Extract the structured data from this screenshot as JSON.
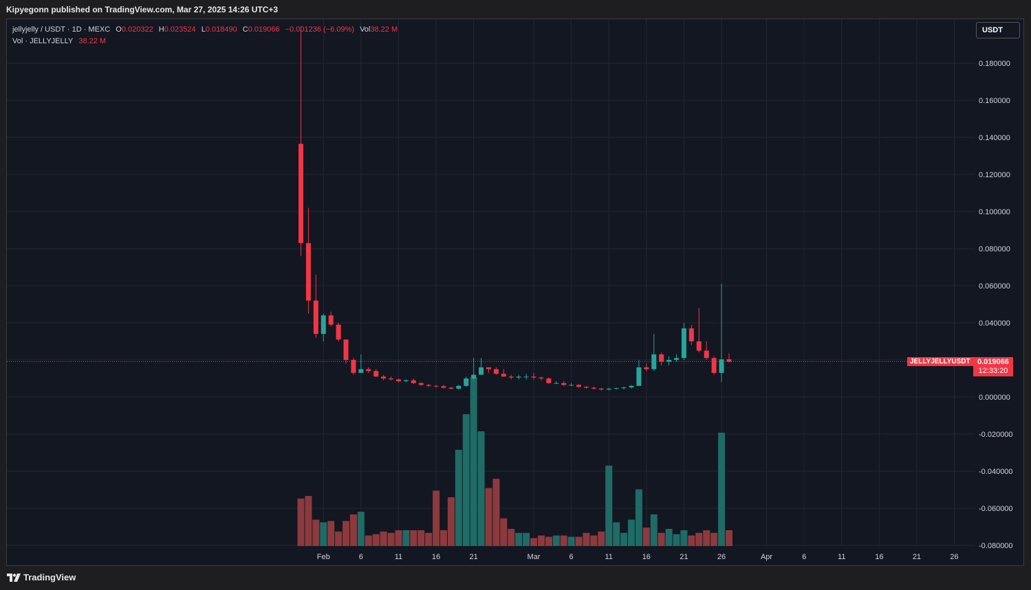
{
  "header": {
    "published": "Kipyegonn published on TradingView.com, Mar 27, 2025 14:26 UTC+3"
  },
  "legend": {
    "symbol": "jellyjelly / USDT · 1D · MEXC",
    "o_label": "O",
    "o": "0.020322",
    "h_label": "H",
    "h": "0.023524",
    "l_label": "L",
    "l": "0.018490",
    "c_label": "C",
    "c": "0.019066",
    "change": "−0.001236 (−6.09%)",
    "vol_label": "Vol",
    "vol": "38.22 M",
    "vol_row_label": "Vol · JELLYJELLY",
    "vol_row_value": "38.22 M"
  },
  "price_scale": {
    "unit": "USDT"
  },
  "last_price": {
    "symbol": "JELLYJELLYUSDT",
    "price": "0.019066",
    "countdown": "12:33:20"
  },
  "footer": {
    "brand": "TradingView"
  },
  "colors": {
    "up": "#26a69a",
    "down": "#f23645",
    "vol_up": "#1f6b66",
    "vol_down": "#8c3a3e",
    "background": "#131722",
    "grid": "#232733"
  },
  "chart_data": {
    "type": "candlestick",
    "ylim": [
      -0.08,
      0.2
    ],
    "y_ticks": [
      "0.180000",
      "0.160000",
      "0.140000",
      "0.120000",
      "0.100000",
      "0.080000",
      "0.060000",
      "0.040000",
      "0.020000",
      "0.000000",
      "-0.020000",
      "-0.040000",
      "-0.060000",
      "-0.080000"
    ],
    "y_tick_values": [
      0.18,
      0.16,
      0.14,
      0.12,
      0.1,
      0.08,
      0.06,
      0.04,
      0.02,
      0,
      -0.02,
      -0.04,
      -0.06,
      -0.08
    ],
    "x_ticks": [
      {
        "label": "Feb",
        "day": 3
      },
      {
        "label": "6",
        "day": 8
      },
      {
        "label": "11",
        "day": 13
      },
      {
        "label": "16",
        "day": 18
      },
      {
        "label": "21",
        "day": 23
      },
      {
        "label": "Mar",
        "day": 31
      },
      {
        "label": "6",
        "day": 36
      },
      {
        "label": "11",
        "day": 41
      },
      {
        "label": "16",
        "day": 46
      },
      {
        "label": "21",
        "day": 51
      },
      {
        "label": "26",
        "day": 56
      },
      {
        "label": "Apr",
        "day": 62
      },
      {
        "label": "6",
        "day": 67
      },
      {
        "label": "11",
        "day": 72
      },
      {
        "label": "16",
        "day": 77
      },
      {
        "label": "21",
        "day": 82
      },
      {
        "label": "26",
        "day": 87
      }
    ],
    "last_price": 0.019066,
    "candles": [
      {
        "day": 0,
        "o": 0.1365,
        "h": 0.2,
        "l": 0.076,
        "c": 0.083,
        "v": 0.36
      },
      {
        "day": 1,
        "o": 0.083,
        "h": 0.102,
        "l": 0.045,
        "c": 0.052,
        "v": 0.38
      },
      {
        "day": 2,
        "o": 0.052,
        "h": 0.066,
        "l": 0.032,
        "c": 0.034,
        "v": 0.2
      },
      {
        "day": 3,
        "o": 0.034,
        "h": 0.045,
        "l": 0.03,
        "c": 0.044,
        "v": 0.18
      },
      {
        "day": 4,
        "o": 0.044,
        "h": 0.046,
        "l": 0.038,
        "c": 0.039,
        "v": 0.19
      },
      {
        "day": 5,
        "o": 0.039,
        "h": 0.04,
        "l": 0.03,
        "c": 0.031,
        "v": 0.11
      },
      {
        "day": 6,
        "o": 0.031,
        "h": 0.031,
        "l": 0.018,
        "c": 0.02,
        "v": 0.19
      },
      {
        "day": 7,
        "o": 0.02,
        "h": 0.021,
        "l": 0.012,
        "c": 0.013,
        "v": 0.24
      },
      {
        "day": 8,
        "o": 0.013,
        "h": 0.023,
        "l": 0.013,
        "c": 0.015,
        "v": 0.26
      },
      {
        "day": 9,
        "o": 0.015,
        "h": 0.016,
        "l": 0.013,
        "c": 0.014,
        "v": 0.08
      },
      {
        "day": 10,
        "o": 0.014,
        "h": 0.015,
        "l": 0.011,
        "c": 0.011,
        "v": 0.09
      },
      {
        "day": 11,
        "o": 0.011,
        "h": 0.012,
        "l": 0.009,
        "c": 0.01,
        "v": 0.11
      },
      {
        "day": 12,
        "o": 0.01,
        "h": 0.011,
        "l": 0.009,
        "c": 0.0095,
        "v": 0.1
      },
      {
        "day": 13,
        "o": 0.0095,
        "h": 0.01,
        "l": 0.008,
        "c": 0.0085,
        "v": 0.12
      },
      {
        "day": 14,
        "o": 0.0085,
        "h": 0.0095,
        "l": 0.008,
        "c": 0.009,
        "v": 0.12
      },
      {
        "day": 15,
        "o": 0.009,
        "h": 0.01,
        "l": 0.007,
        "c": 0.0075,
        "v": 0.12
      },
      {
        "day": 16,
        "o": 0.0075,
        "h": 0.008,
        "l": 0.006,
        "c": 0.0065,
        "v": 0.12
      },
      {
        "day": 17,
        "o": 0.0065,
        "h": 0.007,
        "l": 0.0055,
        "c": 0.006,
        "v": 0.1
      },
      {
        "day": 18,
        "o": 0.006,
        "h": 0.0065,
        "l": 0.005,
        "c": 0.0058,
        "v": 0.42
      },
      {
        "day": 19,
        "o": 0.0058,
        "h": 0.0065,
        "l": 0.0045,
        "c": 0.005,
        "v": 0.12
      },
      {
        "day": 20,
        "o": 0.005,
        "h": 0.0055,
        "l": 0.004,
        "c": 0.0045,
        "v": 0.37
      },
      {
        "day": 21,
        "o": 0.0045,
        "h": 0.0065,
        "l": 0.004,
        "c": 0.006,
        "v": 0.73
      },
      {
        "day": 22,
        "o": 0.006,
        "h": 0.011,
        "l": 0.0055,
        "c": 0.01,
        "v": 1.0
      },
      {
        "day": 23,
        "o": 0.01,
        "h": 0.021,
        "l": 0.009,
        "c": 0.012,
        "v": 1.28
      },
      {
        "day": 24,
        "o": 0.012,
        "h": 0.021,
        "l": 0.012,
        "c": 0.016,
        "v": 0.87
      },
      {
        "day": 25,
        "o": 0.016,
        "h": 0.016,
        "l": 0.013,
        "c": 0.015,
        "v": 0.44
      },
      {
        "day": 26,
        "o": 0.015,
        "h": 0.016,
        "l": 0.012,
        "c": 0.0125,
        "v": 0.51
      },
      {
        "day": 27,
        "o": 0.0125,
        "h": 0.015,
        "l": 0.011,
        "c": 0.011,
        "v": 0.21
      },
      {
        "day": 28,
        "o": 0.011,
        "h": 0.012,
        "l": 0.0095,
        "c": 0.0105,
        "v": 0.13
      },
      {
        "day": 29,
        "o": 0.0105,
        "h": 0.012,
        "l": 0.0095,
        "c": 0.011,
        "v": 0.1
      },
      {
        "day": 30,
        "o": 0.011,
        "h": 0.0125,
        "l": 0.0095,
        "c": 0.011,
        "v": 0.1
      },
      {
        "day": 31,
        "o": 0.011,
        "h": 0.013,
        "l": 0.0095,
        "c": 0.0105,
        "v": 0.06
      },
      {
        "day": 32,
        "o": 0.0105,
        "h": 0.011,
        "l": 0.009,
        "c": 0.01,
        "v": 0.08
      },
      {
        "day": 33,
        "o": 0.01,
        "h": 0.0105,
        "l": 0.007,
        "c": 0.0075,
        "v": 0.07
      },
      {
        "day": 34,
        "o": 0.0075,
        "h": 0.0085,
        "l": 0.007,
        "c": 0.0075,
        "v": 0.08
      },
      {
        "day": 35,
        "o": 0.0075,
        "h": 0.0085,
        "l": 0.006,
        "c": 0.0065,
        "v": 0.08
      },
      {
        "day": 36,
        "o": 0.0065,
        "h": 0.0075,
        "l": 0.006,
        "c": 0.0065,
        "v": 0.07
      },
      {
        "day": 37,
        "o": 0.0065,
        "h": 0.007,
        "l": 0.005,
        "c": 0.0055,
        "v": 0.07
      },
      {
        "day": 38,
        "o": 0.0055,
        "h": 0.006,
        "l": 0.0045,
        "c": 0.005,
        "v": 0.1
      },
      {
        "day": 39,
        "o": 0.005,
        "h": 0.0055,
        "l": 0.004,
        "c": 0.0045,
        "v": 0.08
      },
      {
        "day": 40,
        "o": 0.0045,
        "h": 0.005,
        "l": 0.0035,
        "c": 0.004,
        "v": 0.11
      },
      {
        "day": 41,
        "o": 0.004,
        "h": 0.005,
        "l": 0.0035,
        "c": 0.0045,
        "v": 0.61
      },
      {
        "day": 42,
        "o": 0.0045,
        "h": 0.005,
        "l": 0.004,
        "c": 0.0048,
        "v": 0.18
      },
      {
        "day": 43,
        "o": 0.0048,
        "h": 0.0055,
        "l": 0.004,
        "c": 0.0052,
        "v": 0.1
      },
      {
        "day": 44,
        "o": 0.0052,
        "h": 0.0065,
        "l": 0.0045,
        "c": 0.006,
        "v": 0.2
      },
      {
        "day": 45,
        "o": 0.006,
        "h": 0.02,
        "l": 0.006,
        "c": 0.016,
        "v": 0.43
      },
      {
        "day": 46,
        "o": 0.016,
        "h": 0.018,
        "l": 0.014,
        "c": 0.015,
        "v": 0.14
      },
      {
        "day": 47,
        "o": 0.015,
        "h": 0.034,
        "l": 0.014,
        "c": 0.023,
        "v": 0.24
      },
      {
        "day": 48,
        "o": 0.023,
        "h": 0.024,
        "l": 0.017,
        "c": 0.019,
        "v": 0.1
      },
      {
        "day": 49,
        "o": 0.019,
        "h": 0.022,
        "l": 0.017,
        "c": 0.02,
        "v": 0.13
      },
      {
        "day": 50,
        "o": 0.02,
        "h": 0.023,
        "l": 0.019,
        "c": 0.021,
        "v": 0.09
      },
      {
        "day": 51,
        "o": 0.021,
        "h": 0.04,
        "l": 0.02,
        "c": 0.037,
        "v": 0.12
      },
      {
        "day": 52,
        "o": 0.037,
        "h": 0.039,
        "l": 0.028,
        "c": 0.03,
        "v": 0.08
      },
      {
        "day": 53,
        "o": 0.03,
        "h": 0.048,
        "l": 0.024,
        "c": 0.025,
        "v": 0.1
      },
      {
        "day": 54,
        "o": 0.025,
        "h": 0.03,
        "l": 0.02,
        "c": 0.021,
        "v": 0.12
      },
      {
        "day": 55,
        "o": 0.021,
        "h": 0.022,
        "l": 0.012,
        "c": 0.013,
        "v": 0.1
      },
      {
        "day": 56,
        "o": 0.013,
        "h": 0.061,
        "l": 0.008,
        "c": 0.0203,
        "v": 0.86
      },
      {
        "day": 57,
        "o": 0.020322,
        "h": 0.023524,
        "l": 0.01849,
        "c": 0.019066,
        "v": 0.12
      }
    ]
  }
}
